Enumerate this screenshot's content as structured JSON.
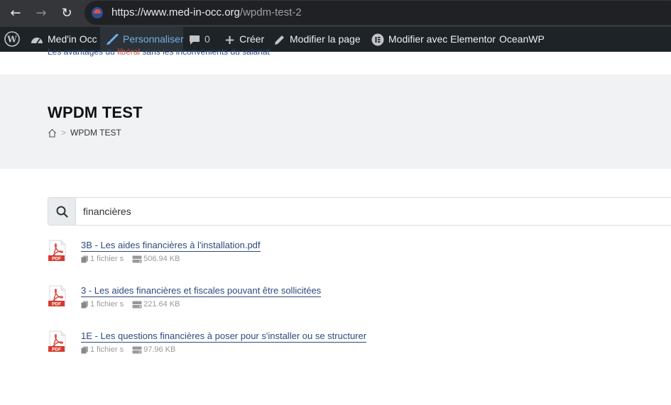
{
  "browser": {
    "url_domain": "https://www.med-in-occ.org",
    "url_path": "/wpdm-test-2"
  },
  "admin_bar": {
    "site_name": "Med'in Occ",
    "customize": "Personnaliser",
    "comments_count": "0",
    "new": "Créer",
    "edit_page": "Modifier la page",
    "elementor": "Modifier avec Elementor",
    "theme": "OceanWP"
  },
  "topline": {
    "part1": "Les avantages du ",
    "highlight": "libéral",
    "part2": " sans les inconvénients du salariat"
  },
  "page": {
    "title": "WPDM TEST",
    "breadcrumb_sep": ">",
    "breadcrumb_current": "WPDM TEST"
  },
  "search": {
    "value": "financières"
  },
  "results": [
    {
      "title": "3B - Les aides financières à l'installation.pdf",
      "files": "1 fichier s",
      "size": "506.94 KB",
      "icon_label": "PDF"
    },
    {
      "title": "3 - Les aides financières et fiscales pouvant être sollicitées",
      "files": "1 fichier s",
      "size": "221.64 KB",
      "icon_label": "PDF"
    },
    {
      "title": "1E - Les questions financières à poser pour s'installer ou se structurer",
      "files": "1 fichier s",
      "size": "97.96 KB",
      "icon_label": "PDF"
    }
  ]
}
